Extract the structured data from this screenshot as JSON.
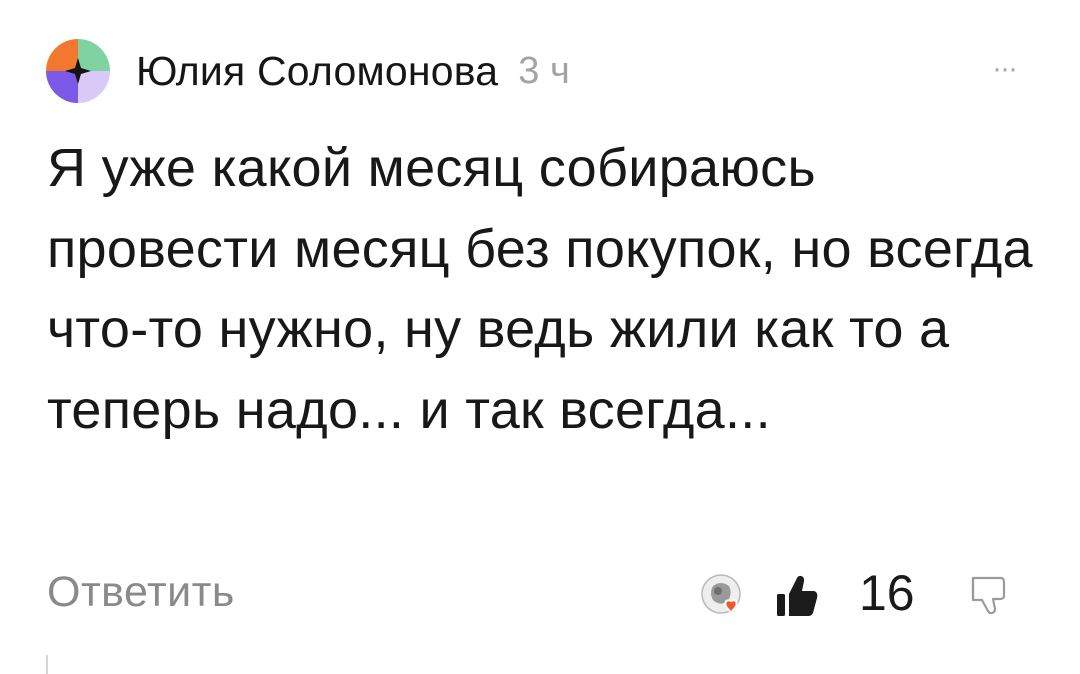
{
  "comment": {
    "author": "Юлия Соломонова",
    "time": "3 ч",
    "more_label": "···",
    "text": "Я уже какой месяц собираюсь провести месяц без покупок, но всегда что-то нужно, ну ведь жили как то а теперь надо... и так всегда...",
    "avatar_colors": [
      "#f2772f",
      "#7fd3a0",
      "#7b58e6",
      "#d8c9f6"
    ],
    "avatar_icon": "four-quadrant-avatar"
  },
  "footer": {
    "reply_label": "Ответить",
    "reactions_icon": "reaction-avatar-with-heart",
    "heart_color": "#f2592a",
    "like_icon": "thumbs-up-icon",
    "like_count": "16",
    "dislike_icon": "thumbs-down-icon"
  }
}
